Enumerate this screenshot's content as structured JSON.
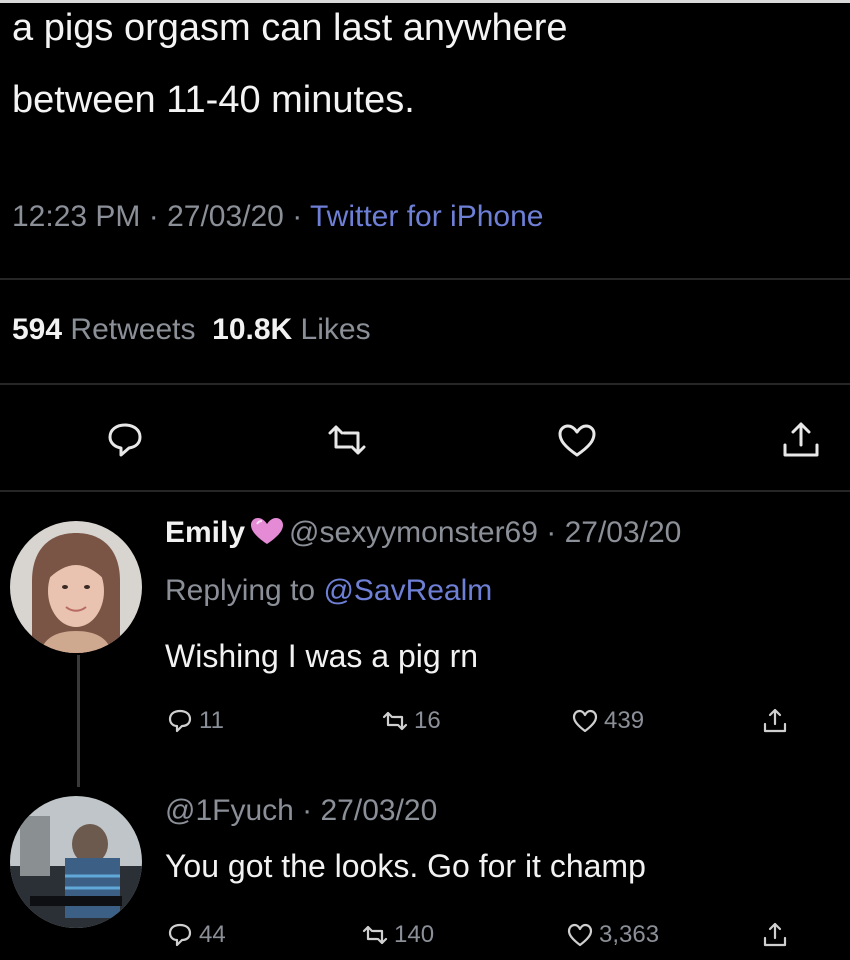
{
  "tweet": {
    "text_line1": "a pigs orgasm can last anywhere",
    "text_line2": "between 11-40 minutes.",
    "time": "12:23 PM",
    "date": "27/03/20",
    "source": "Twitter for iPhone",
    "retweets_count": "594",
    "retweets_label": "Retweets",
    "likes_count": "10.8K",
    "likes_label": "Likes"
  },
  "actions": {
    "icons": [
      "reply-icon",
      "retweet-icon",
      "like-icon",
      "share-icon"
    ]
  },
  "reply1": {
    "name": "Emily",
    "emoji": "pink-heart-emoji",
    "handle_date": "@sexyymonster69 · 27/03/20",
    "replying_prefix": "Replying to",
    "replying_handle": "@SavRealm",
    "text": "Wishing I was a pig rn",
    "replies": "11",
    "retweets": "16",
    "likes": "439"
  },
  "reply2": {
    "handle_date": "@1Fyuch · 27/03/20",
    "text": "You got the looks. Go for it champ",
    "replies": "44",
    "retweets": "140",
    "likes": "3,363"
  },
  "colors": {
    "background": "#000000",
    "text": "#f2f2f2",
    "muted": "#8b8f97",
    "link": "#6e7fd6",
    "heart": "#e58bd6"
  }
}
